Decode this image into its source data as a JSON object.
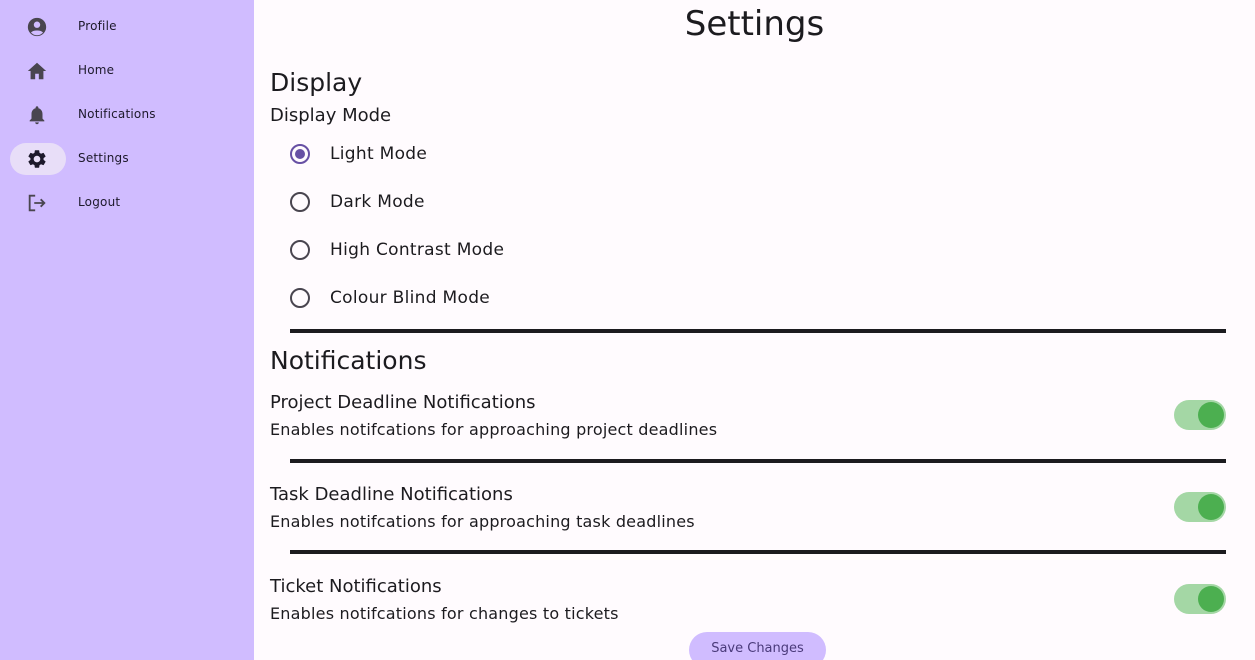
{
  "sidebar": {
    "items": [
      {
        "label": "Profile",
        "icon": "account-circle-icon"
      },
      {
        "label": "Home",
        "icon": "home-icon"
      },
      {
        "label": "Notifications",
        "icon": "bell-icon"
      },
      {
        "label": "Settings",
        "icon": "gear-icon",
        "active": true
      },
      {
        "label": "Logout",
        "icon": "logout-icon"
      }
    ]
  },
  "main": {
    "title": "Settings",
    "display": {
      "heading": "Display",
      "subheading": "Display Mode",
      "options": [
        {
          "label": "Light Mode",
          "selected": true
        },
        {
          "label": "Dark Mode",
          "selected": false
        },
        {
          "label": "High Contrast Mode",
          "selected": false
        },
        {
          "label": "Colour Blind Mode",
          "selected": false
        }
      ]
    },
    "notifications": {
      "heading": "Notifications",
      "items": [
        {
          "title": "Project Deadline Notifications",
          "description": "Enables notifcations for approaching project deadlines",
          "enabled": true
        },
        {
          "title": "Task Deadline Notifications",
          "description": "Enables notifcations for approaching task deadlines",
          "enabled": true
        },
        {
          "title": "Ticket Notifications",
          "description": "Enables notifcations for changes to tickets",
          "enabled": true
        }
      ]
    },
    "save_label": "Save Changes"
  },
  "colors": {
    "sidebar_bg": "#d0bcff",
    "active_indicator": "#e8def8",
    "radio_selected": "#6750a4",
    "switch_track": "#a4d7a5",
    "switch_thumb": "#4caf50"
  }
}
